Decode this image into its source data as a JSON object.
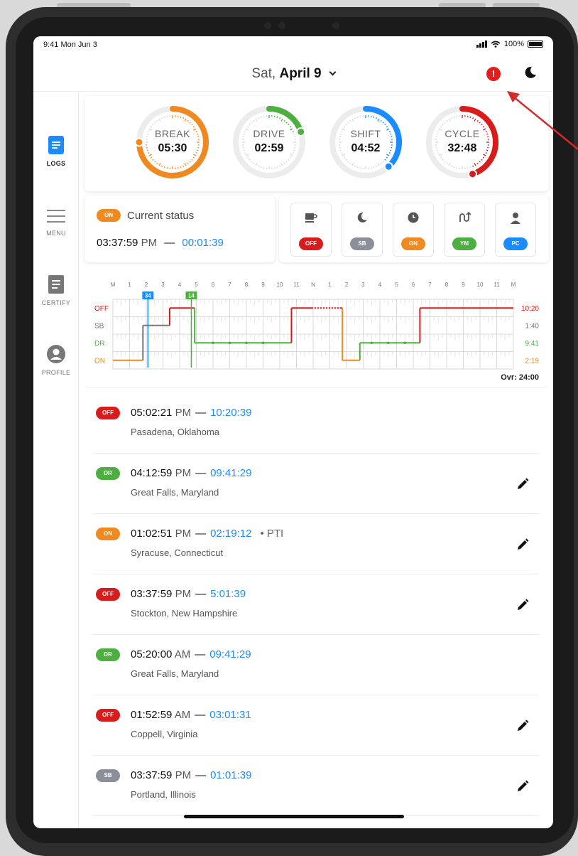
{
  "status_bar": {
    "time": "9:41 Mon Jun 3",
    "battery": "100%"
  },
  "header": {
    "date_prefix": "Sat,",
    "date_main": "April 9",
    "alert_symbol": "!"
  },
  "sidebar": {
    "items": [
      {
        "label": "LOGS",
        "active": true
      },
      {
        "label": "MENU",
        "active": false
      },
      {
        "label": "CERTIFY",
        "active": false
      },
      {
        "label": "PROFILE",
        "active": false
      }
    ]
  },
  "timers": [
    {
      "label": "BREAK",
      "value": "05:30",
      "color": "#f0891f",
      "fraction": 0.75
    },
    {
      "label": "DRIVE",
      "value": "02:59",
      "color": "#4caf3f",
      "fraction": 0.2
    },
    {
      "label": "SHIFT",
      "value": "04:52",
      "color": "#1a8cff",
      "fraction": 0.38
    },
    {
      "label": "CYCLE",
      "value": "32:48",
      "color": "#d81b1b",
      "fraction": 0.45
    }
  ],
  "current_status": {
    "badge": "ON",
    "title": "Current status",
    "start_time": "03:37:59",
    "start_ampm": "PM",
    "dash": "—",
    "duration": "00:01:39"
  },
  "status_buttons": [
    {
      "label": "OFF",
      "color": "#d81b1b",
      "icon": "coffee-icon"
    },
    {
      "label": "SB",
      "color": "#8a8f99",
      "icon": "moon-icon"
    },
    {
      "label": "ON",
      "color": "#f0891f",
      "icon": "clock-icon"
    },
    {
      "label": "YM",
      "color": "#4caf3f",
      "icon": "route-icon"
    },
    {
      "label": "PC",
      "color": "#1a8cff",
      "icon": "person-icon"
    }
  ],
  "graph": {
    "hours": [
      "M",
      "1",
      "2",
      "3",
      "4",
      "5",
      "6",
      "7",
      "8",
      "9",
      "10",
      "11",
      "N",
      "1",
      "2",
      "3",
      "4",
      "5",
      "6",
      "7",
      "8",
      "9",
      "10",
      "11",
      "M"
    ],
    "rows": [
      "OFF",
      "SB",
      "DR",
      "ON"
    ],
    "totals": [
      "10:20",
      "1:40",
      "9:41",
      "2:19"
    ],
    "markers": [
      "34",
      "14"
    ],
    "overall": "Ovr: 24:00"
  },
  "logs": [
    {
      "status": "OFF",
      "color": "#d81b1b",
      "time": "05:02:21",
      "ampm": "PM",
      "duration": "10:20:39",
      "location": "Pasadena, Oklahoma",
      "note": "",
      "editable": false
    },
    {
      "status": "DR",
      "color": "#4caf3f",
      "time": "04:12:59",
      "ampm": "PM",
      "duration": "09:41:29",
      "location": "Great Falls, Maryland",
      "note": "",
      "editable": true
    },
    {
      "status": "ON",
      "color": "#f0891f",
      "time": "01:02:51",
      "ampm": "PM",
      "duration": "02:19:12",
      "location": "Syracuse, Connecticut",
      "note": "•  PTI",
      "editable": true
    },
    {
      "status": "OFF",
      "color": "#d81b1b",
      "time": "03:37:59",
      "ampm": "PM",
      "duration": "5:01:39",
      "location": "Stockton, New Hampshire",
      "note": "",
      "editable": true
    },
    {
      "status": "DR",
      "color": "#4caf3f",
      "time": "05:20:00",
      "ampm": "AM",
      "duration": "09:41:29",
      "location": "Great Falls, Maryland",
      "note": "",
      "editable": false
    },
    {
      "status": "OFF",
      "color": "#d81b1b",
      "time": "01:52:59",
      "ampm": "AM",
      "duration": "03:01:31",
      "location": "Coppell, Virginia",
      "note": "",
      "editable": true
    },
    {
      "status": "SB",
      "color": "#8a8f99",
      "time": "03:37:59",
      "ampm": "PM",
      "duration": "01:01:39",
      "location": "Portland, Illinois",
      "note": "",
      "editable": true
    }
  ]
}
